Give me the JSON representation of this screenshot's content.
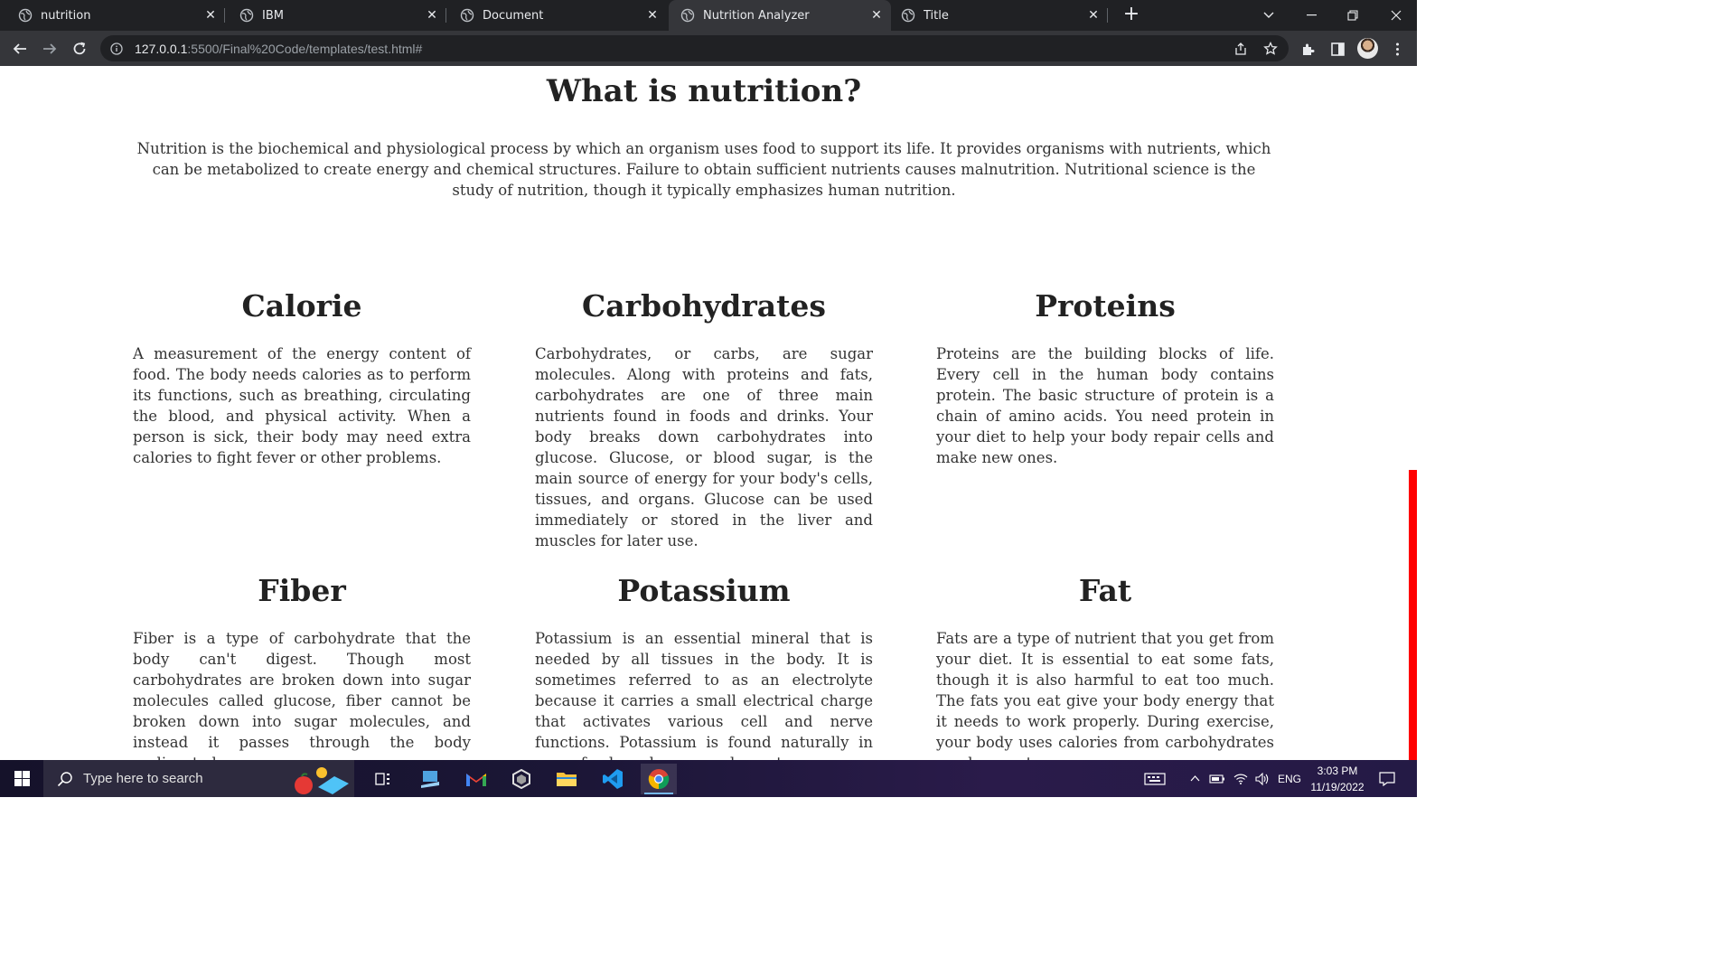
{
  "browser": {
    "tabs": [
      {
        "title": "nutrition",
        "active": false
      },
      {
        "title": "IBM",
        "active": false
      },
      {
        "title": "Document",
        "active": false
      },
      {
        "title": "Nutrition Analyzer",
        "active": true
      },
      {
        "title": "Title",
        "active": false
      }
    ],
    "new_tab_label": "+",
    "url_host": "127.0.0.1",
    "url_rest": ":5500/Final%20Code/templates/test.html#"
  },
  "page": {
    "title": "What is nutrition?",
    "intro": "Nutrition is the biochemical and physiological process by which an organism uses food to support its life. It provides organisms with nutrients, which can be metabolized to create energy and chemical structures. Failure to obtain sufficient nutrients causes malnutrition. Nutritional science is the study of nutrition, though it typically emphasizes human nutrition.",
    "cards": [
      {
        "heading": "Calorie",
        "text": "A measurement of the energy content of food. The body needs calories as to perform its functions, such as breathing, circulating the blood, and physical activity. When a person is sick, their body may need extra calories to fight fever or other problems."
      },
      {
        "heading": "Carbohydrates",
        "text": "Carbohydrates, or carbs, are sugar molecules. Along with proteins and fats, carbohydrates are one of three main nutrients found in foods and drinks. Your body breaks down carbohydrates into glucose. Glucose, or blood sugar, is the main source of energy for your body's cells, tissues, and organs. Glucose can be used immediately or stored in the liver and muscles for later use."
      },
      {
        "heading": "Proteins",
        "text": "Proteins are the building blocks of life. Every cell in the human body contains protein. The basic structure of protein is a chain of amino acids. You need protein in your diet to help your body repair cells and make new ones."
      },
      {
        "heading": "Fiber",
        "text": "Fiber is a type of carbohydrate that the body can't digest. Though most carbohydrates are broken down into sugar molecules called glucose, fiber cannot be broken down into sugar molecules, and instead it passes through the body undigested."
      },
      {
        "heading": "Potassium",
        "text": "Potassium is an essential mineral that is needed by all tissues in the body. It is sometimes referred to as an electrolyte because it carries a small electrical charge that activates various cell and nerve functions. Potassium is found naturally in many foods and as a supplement."
      },
      {
        "heading": "Fat",
        "text": "Fats are a type of nutrient that you get from your diet. It is essential to eat some fats, though it is also harmful to eat too much. The fats you eat give your body energy that it needs to work properly. During exercise, your body uses calories from carbohydrates you have eaten."
      }
    ]
  },
  "taskbar": {
    "search_placeholder": "Type here to search",
    "apps": [
      "task-view-icon",
      "azure-data-studio-icon",
      "gmail-icon",
      "unity-icon",
      "file-explorer-icon",
      "vscode-icon",
      "chrome-icon"
    ],
    "language": "ENG",
    "time": "3:03 PM",
    "date": "11/19/2022"
  },
  "colors": {
    "tabstrip": "#202124",
    "toolbar": "#35363a",
    "scroll_thumb": "#ff0000"
  }
}
